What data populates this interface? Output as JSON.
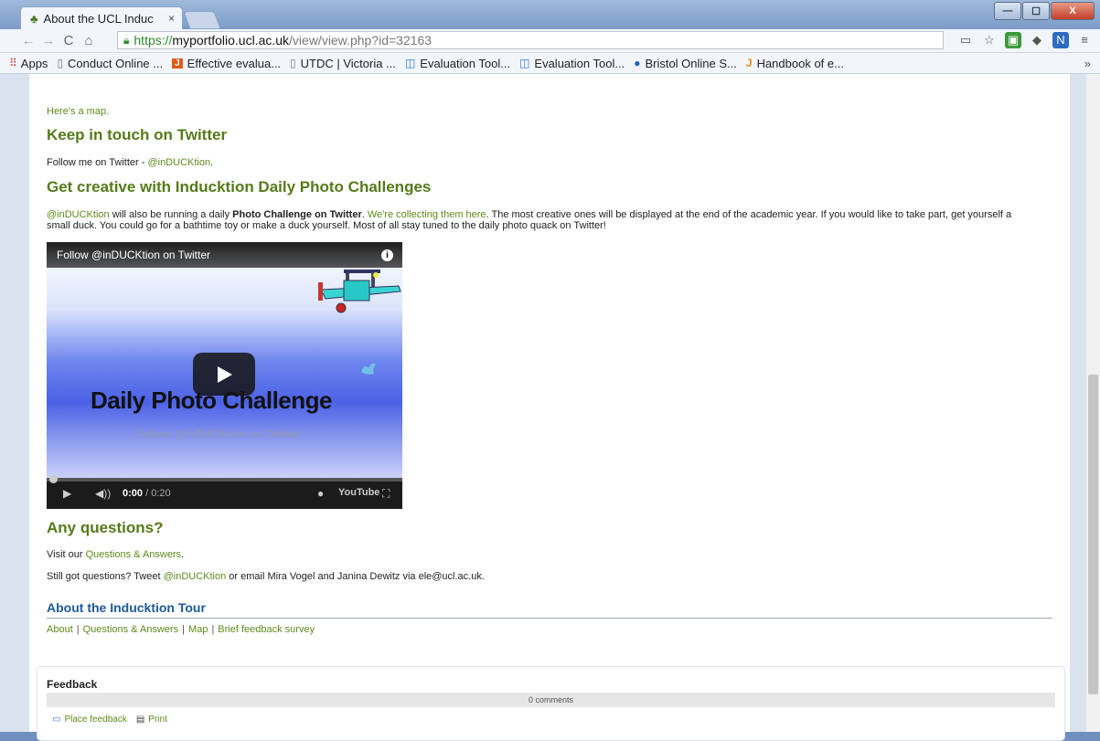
{
  "browser": {
    "tab_title": "About the UCL Induc",
    "tab_close": "×",
    "url_scheme": "https://",
    "url_host": "myportfolio.ucl.ac.uk",
    "url_path": "/view/view.php?id=32163",
    "window_buttons": {
      "minimize": "—",
      "maximize": "☐",
      "close": "X"
    }
  },
  "bookmarks": [
    {
      "label": "Apps",
      "icon": "apps-grid-icon"
    },
    {
      "label": "Conduct Online ...",
      "icon": "page-icon"
    },
    {
      "label": "Effective evalua...",
      "icon": "j-icon"
    },
    {
      "label": "UTDC | Victoria ...",
      "icon": "page-icon"
    },
    {
      "label": "Evaluation Tool...",
      "icon": "trello-icon"
    },
    {
      "label": "Evaluation Tool...",
      "icon": "trello-icon"
    },
    {
      "label": "Bristol Online S...",
      "icon": "bristol-icon"
    },
    {
      "label": "Handbook of e...",
      "icon": "jisc-icon"
    }
  ],
  "bookmarks_more": "»",
  "content": {
    "map_link": "Here's a map.",
    "twitter_heading": "Keep in touch on Twitter",
    "twitter_text": "Follow me on Twitter - ",
    "twitter_handle": "@inDUCKtion",
    "twitter_text_end": ".",
    "creative_heading": "Get creative with Inducktion Daily Photo Challenges",
    "creative_handle": "@inDUCKtion",
    "creative_t1": " will also be running a daily ",
    "creative_bold": "Photo Challenge on Twitter",
    "creative_t2": ". ",
    "creative_link": "We're collecting them here",
    "creative_t3": ". The most creative ones will be displayed at the end of the academic year. If you would like to take part, get yourself a",
    "creative_line2": "small duck. You could go for a bathtime toy or make a duck yourself. Most of all stay tuned to the daily photo quack on Twitter!",
    "questions_heading": "Any questions?",
    "visit_text": "Visit our ",
    "qa_link": "Questions & Answers",
    "visit_end": ".",
    "still_text": "Still got questions? Tweet ",
    "still_handle": "@inDUCKtion",
    "still_end": " or email Mira Vogel and Janina Dewitz via ele@ucl.ac.uk."
  },
  "video": {
    "title": "Follow @inDUCKtion on Twitter",
    "main_text": "Daily Photo Challenge",
    "sub_text": "Follow @inDUCKtion on Twitter",
    "time_current": "0:00",
    "time_total": " / 0:20",
    "brand": "YouTube",
    "progress": 0
  },
  "about": {
    "heading": "About the Inducktion Tour",
    "links": [
      "About",
      "Questions & Answers",
      "Map",
      "Brief feedback survey"
    ],
    "sep": "|"
  },
  "feedback": {
    "title": "Feedback",
    "comments": "0 comments",
    "place_feedback": "Place feedback",
    "print": "Print"
  }
}
